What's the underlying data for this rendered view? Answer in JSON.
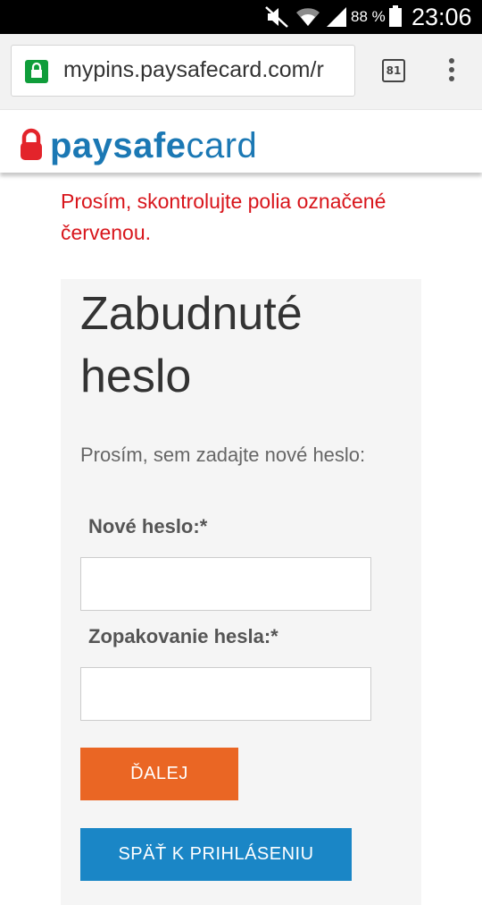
{
  "status_bar": {
    "battery": "88 %",
    "time": "23:06",
    "icons": [
      "mute-icon",
      "wifi-icon",
      "signal-icon",
      "battery-icon"
    ]
  },
  "browser": {
    "url": "mypins.paysafecard.com/r",
    "tab_count": "81",
    "icons": [
      "lock-icon",
      "tabs-icon",
      "overflow-menu-icon"
    ]
  },
  "header": {
    "logo_pay": "paysafe",
    "logo_card": "card"
  },
  "error_message": "Prosím, skontrolujte polia označené červenou.",
  "form": {
    "title": "Zabudnuté heslo",
    "subtitle": "Prosím, sem zadajte nové heslo:",
    "new_password_label": "Nové heslo:*",
    "new_password_value": "",
    "repeat_password_label": "Zopakovanie hesla:*",
    "repeat_password_value": "",
    "next_button": "ĎALEJ",
    "back_button": "SPÄŤ K PRIHLÁSENIU"
  },
  "colors": {
    "error": "#d8151b",
    "brand_blue": "#1b78b4",
    "brand_red": "#e3242b",
    "next_button": "#ea6624",
    "back_button": "#1a86c6",
    "secure_lock": "#0f9d3a"
  }
}
